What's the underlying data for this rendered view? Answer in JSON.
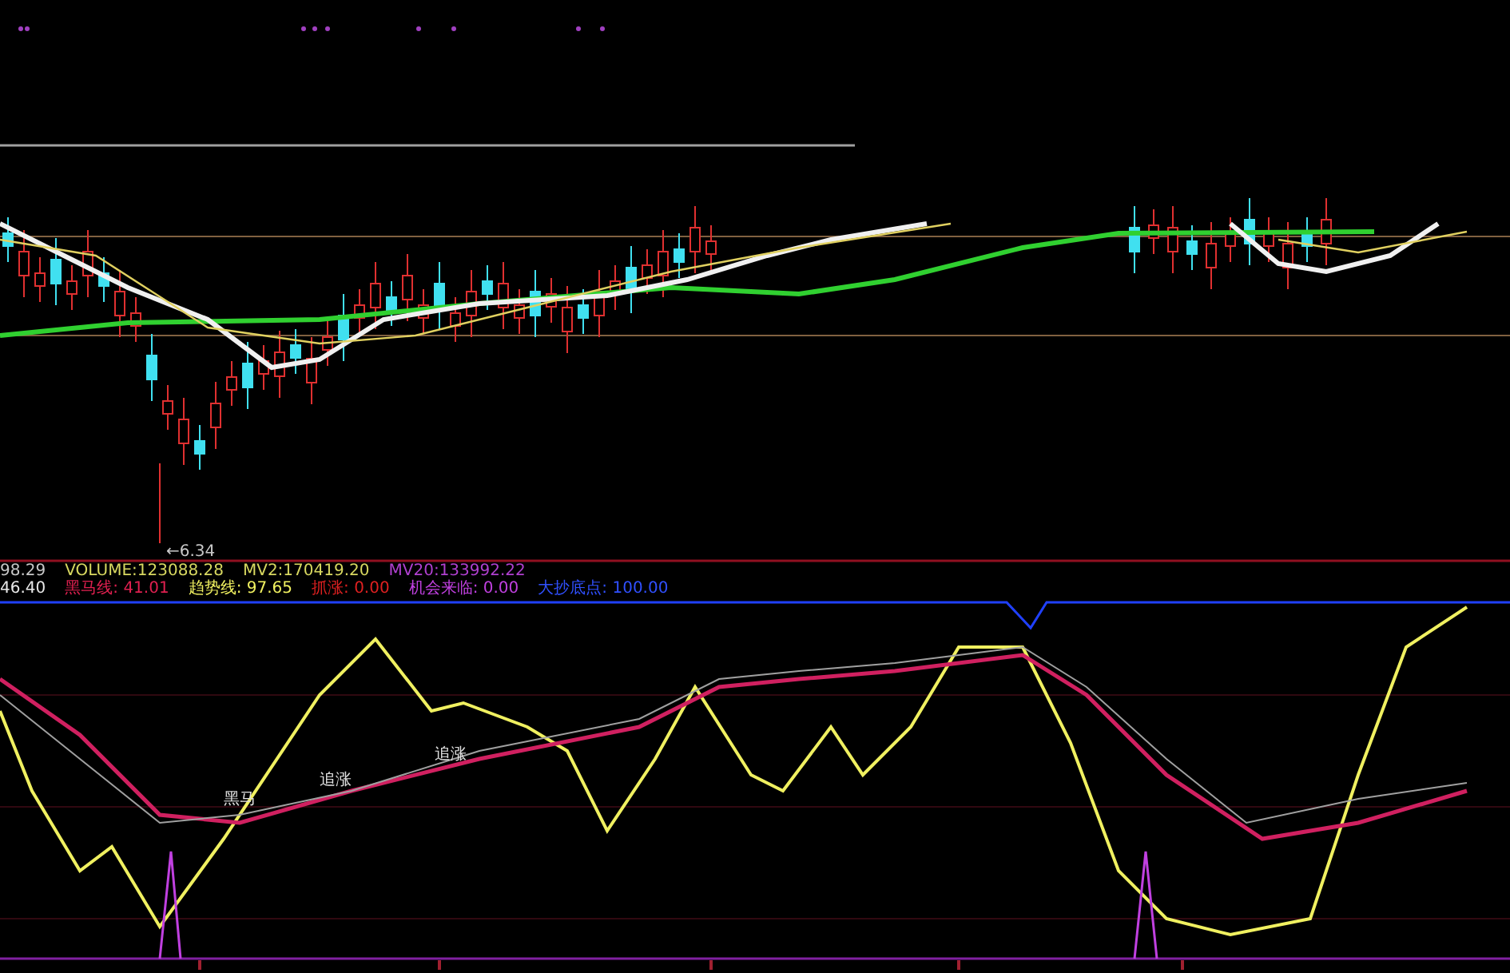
{
  "price_pane": {
    "low_label": "←6.34"
  },
  "info_rows": [
    {
      "items": [
        {
          "text": "98.29",
          "color": "#c8c8c8"
        },
        {
          "text": "VOLUME:123088.28",
          "color": "#d8d860"
        },
        {
          "text": "MV2:170419.20",
          "color": "#d8d860"
        },
        {
          "text": "MV20:133992.22",
          "color": "#b040d0"
        }
      ]
    },
    {
      "items": [
        {
          "text": "46.40",
          "color": "#e8e8e8"
        },
        {
          "text": "黑马线: 41.01",
          "color": "#e02050"
        },
        {
          "text": "趋势线: 97.65",
          "color": "#f0f060"
        },
        {
          "text": "抓涨: 0.00",
          "color": "#e02020"
        },
        {
          "text": "机会来临: 0.00",
          "color": "#c040e0"
        },
        {
          "text": "大抄底点: 100.00",
          "color": "#3050ff"
        }
      ]
    }
  ],
  "indicator_pane": {
    "labels": [
      "黑马",
      "追涨",
      "追涨"
    ]
  }
}
